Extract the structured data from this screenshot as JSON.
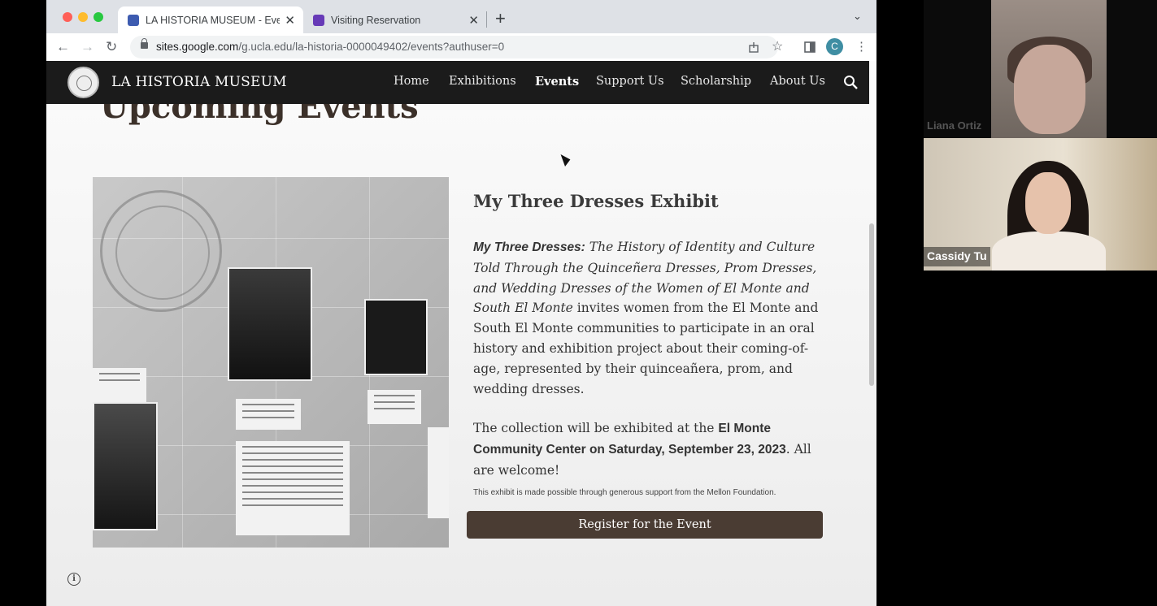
{
  "browser": {
    "tabs": [
      {
        "title": "LA HISTORIA MUSEUM - Event",
        "active": true
      },
      {
        "title": "Visiting Reservation",
        "active": false
      }
    ],
    "url": {
      "domain": "sites.google.com",
      "path": "/g.ucla.edu/la-historia-0000049402/events?authuser=0"
    },
    "profile_initial": "C"
  },
  "site": {
    "title": "LA HISTORIA MUSEUM",
    "nav": [
      "Home",
      "Exhibitions",
      "Events",
      "Support Us",
      "Scholarship",
      "About Us"
    ],
    "current_nav": "Events"
  },
  "page": {
    "heading": "Upcoming Events",
    "event": {
      "title": "My Three Dresses Exhibit",
      "desc_bold": "My Three Dresses:",
      "desc_italic": " The History of Identity and Culture Told Through the Quinceñera Dresses, Prom Dresses, and Wedding Dresses of the Women of El Monte and South El Monte",
      "desc_rest": " invites women from the El Monte and South El Monte communities to participate in an oral history and exhibition project about their coming-of-age, represented by their quinceañera, prom, and wedding dresses.",
      "venue_prefix": "The collection will be exhibited at the ",
      "venue_bold": "El Monte Community Center on Saturday, September 23, 2023",
      "venue_suffix": ". All are welcome!",
      "note": "This exhibit is made possible through generous support from the Mellon Foundation.",
      "register_label": "Register for the Event"
    },
    "info_icon": "i"
  },
  "video": {
    "participants": [
      {
        "name": "Liana Ortiz"
      },
      {
        "name": "Cassidy Tu"
      }
    ]
  },
  "colors": {
    "nav_bg": "#1b1b1b",
    "button_bg": "#4a3c33",
    "heading": "#3b3029"
  }
}
